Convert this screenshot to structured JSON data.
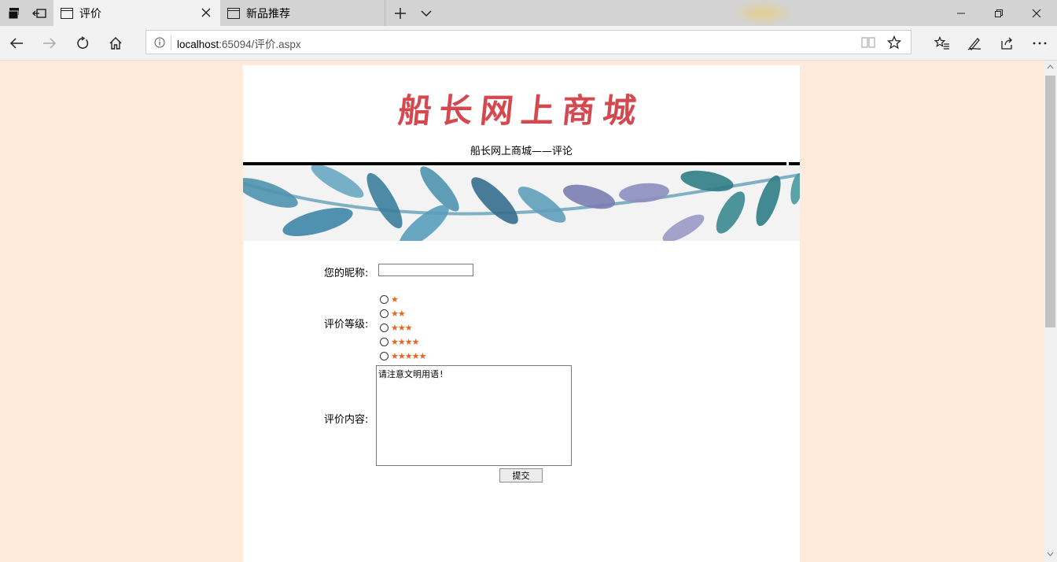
{
  "browser": {
    "tabs": [
      {
        "label": "评价",
        "active": true
      },
      {
        "label": "新品推荐",
        "active": false
      }
    ],
    "url_host": "localhost",
    "url_rest": ":65094/评价.aspx"
  },
  "page": {
    "logo_text": "船长网上商城",
    "subtitle": "船长网上商城——评论",
    "form": {
      "nickname_label": "您的昵称:",
      "nickname_value": "",
      "rating_label": "评价等级:",
      "rating_options": [
        "★",
        "★★",
        "★★★",
        "★★★★",
        "★★★★★"
      ],
      "content_label": "评价内容:",
      "content_value": "请注意文明用语!",
      "submit_label": "提交"
    }
  },
  "colors": {
    "page_background": "#ffebdc",
    "logo": "#d4494f",
    "stars": "#e8651d"
  }
}
